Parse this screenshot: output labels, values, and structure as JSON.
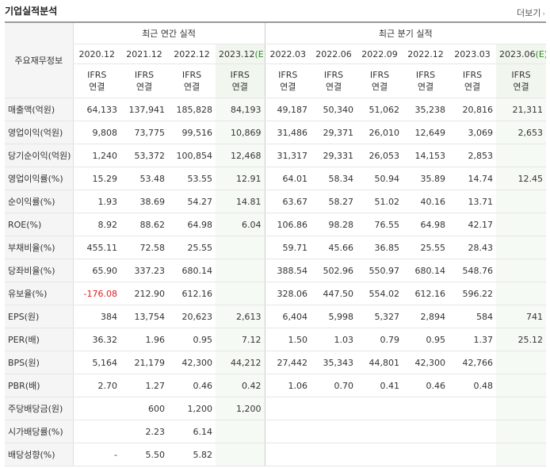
{
  "header": {
    "title": "기업실적분석",
    "more_label": "더보기"
  },
  "table": {
    "corner_label": "주요재무정보",
    "group_annual": "최근 연간 실적",
    "group_quarter": "최근 분기 실적",
    "periods": [
      {
        "label": "2020.12",
        "est": "",
        "std1": "IFRS",
        "std2": "연결"
      },
      {
        "label": "2021.12",
        "est": "",
        "std1": "IFRS",
        "std2": "연결"
      },
      {
        "label": "2022.12",
        "est": "",
        "std1": "IFRS",
        "std2": "연결"
      },
      {
        "label": "2023.12",
        "est": "(E)",
        "std1": "IFRS",
        "std2": "연결"
      },
      {
        "label": "2022.03",
        "est": "",
        "std1": "IFRS",
        "std2": "연결"
      },
      {
        "label": "2022.06",
        "est": "",
        "std1": "IFRS",
        "std2": "연결"
      },
      {
        "label": "2022.09",
        "est": "",
        "std1": "IFRS",
        "std2": "연결"
      },
      {
        "label": "2022.12",
        "est": "",
        "std1": "IFRS",
        "std2": "연결"
      },
      {
        "label": "2023.03",
        "est": "",
        "std1": "IFRS",
        "std2": "연결"
      },
      {
        "label": "2023.06",
        "est": "(E)",
        "std1": "IFRS",
        "std2": "연결"
      }
    ],
    "rows": [
      {
        "label": "매출액(억원)",
        "values": [
          "64,133",
          "137,941",
          "185,828",
          "84,193",
          "49,187",
          "50,340",
          "51,062",
          "35,238",
          "20,816",
          "21,311"
        ]
      },
      {
        "label": "영업이익(억원)",
        "values": [
          "9,808",
          "73,775",
          "99,516",
          "10,869",
          "31,486",
          "29,371",
          "26,010",
          "12,649",
          "3,069",
          "2,653"
        ]
      },
      {
        "label": "당기순이익(억원)",
        "values": [
          "1,240",
          "53,372",
          "100,854",
          "12,468",
          "31,317",
          "29,331",
          "26,053",
          "14,153",
          "2,853",
          ""
        ]
      },
      {
        "label": "영업이익률(%)",
        "values": [
          "15.29",
          "53.48",
          "53.55",
          "12.91",
          "64.01",
          "58.34",
          "50.94",
          "35.89",
          "14.74",
          "12.45"
        ]
      },
      {
        "label": "순이익률(%)",
        "values": [
          "1.93",
          "38.69",
          "54.27",
          "14.81",
          "63.67",
          "58.27",
          "51.02",
          "40.16",
          "13.71",
          ""
        ]
      },
      {
        "label": "ROE(%)",
        "values": [
          "8.92",
          "88.62",
          "64.98",
          "6.04",
          "106.86",
          "98.28",
          "76.55",
          "64.98",
          "42.17",
          ""
        ]
      },
      {
        "label": "부채비율(%)",
        "values": [
          "455.11",
          "72.58",
          "25.55",
          "",
          "59.71",
          "45.66",
          "36.85",
          "25.55",
          "28.43",
          ""
        ]
      },
      {
        "label": "당좌비율(%)",
        "values": [
          "65.90",
          "337.23",
          "680.14",
          "",
          "388.54",
          "502.96",
          "550.97",
          "680.14",
          "548.76",
          ""
        ]
      },
      {
        "label": "유보율(%)",
        "values": [
          "-176.08",
          "212.90",
          "612.16",
          "",
          "328.06",
          "447.50",
          "554.02",
          "612.16",
          "596.22",
          ""
        ]
      },
      {
        "label": "EPS(원)",
        "values": [
          "384",
          "13,754",
          "20,623",
          "2,613",
          "6,404",
          "5,998",
          "5,327",
          "2,894",
          "584",
          "741"
        ]
      },
      {
        "label": "PER(배)",
        "values": [
          "36.32",
          "1.96",
          "0.95",
          "7.12",
          "1.50",
          "1.03",
          "0.79",
          "0.95",
          "1.37",
          "25.12"
        ]
      },
      {
        "label": "BPS(원)",
        "values": [
          "5,164",
          "21,179",
          "42,300",
          "44,212",
          "27,442",
          "35,343",
          "44,801",
          "42,300",
          "42,766",
          ""
        ]
      },
      {
        "label": "PBR(배)",
        "values": [
          "2.70",
          "1.27",
          "0.46",
          "0.42",
          "1.06",
          "0.70",
          "0.41",
          "0.46",
          "0.48",
          ""
        ]
      },
      {
        "label": "주당배당금(원)",
        "values": [
          "",
          "600",
          "1,200",
          "1,200",
          "",
          "",
          "",
          "",
          "",
          ""
        ]
      },
      {
        "label": "시가배당률(%)",
        "values": [
          "",
          "2.23",
          "6.14",
          "",
          "",
          "",
          "",
          "",
          "",
          ""
        ]
      },
      {
        "label": "배당성향(%)",
        "values": [
          "-",
          "5.50",
          "5.82",
          "",
          "",
          "",
          "",
          "",
          "",
          ""
        ]
      }
    ]
  }
}
